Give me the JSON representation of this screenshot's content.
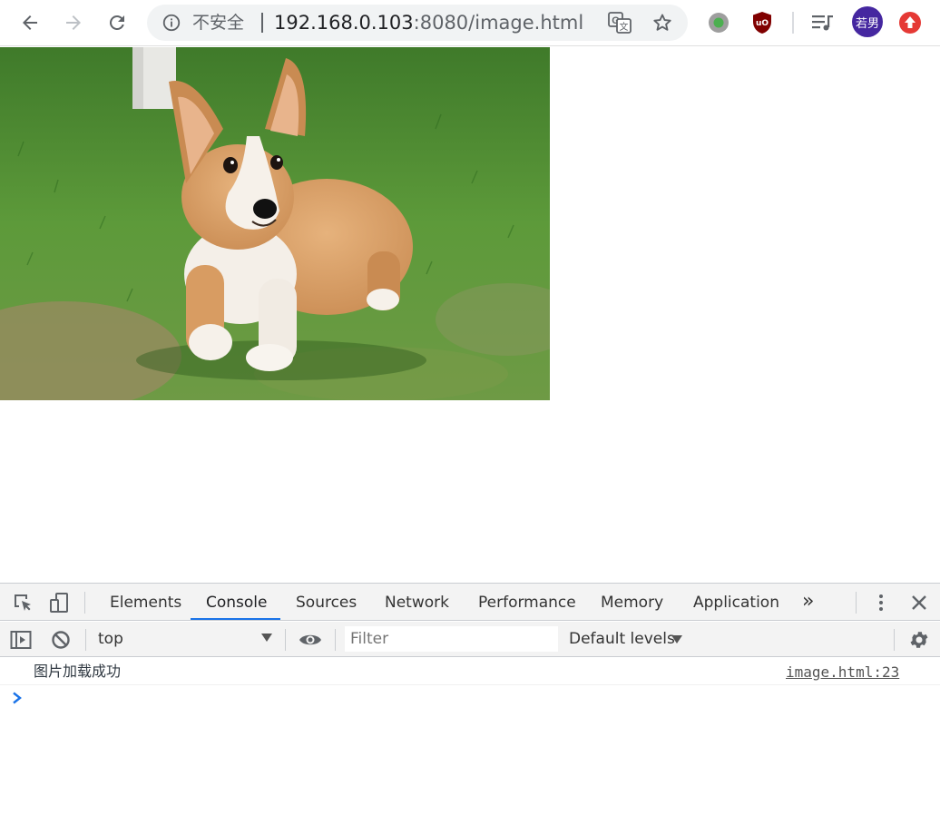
{
  "browser": {
    "security_label": "不安全",
    "url_host": "192.168.0.103",
    "url_rest": ":8080/image.html",
    "profile_name": "若男",
    "colors": {
      "avatar": "#4527a0",
      "ublock": "#800000",
      "ext_green": "#4caf50",
      "update_red": "#e53935"
    }
  },
  "page": {
    "image_alt": "corgi puppy on grass"
  },
  "devtools": {
    "tabs": [
      {
        "label": "Elements"
      },
      {
        "label": "Console"
      },
      {
        "label": "Sources"
      },
      {
        "label": "Network"
      },
      {
        "label": "Performance"
      },
      {
        "label": "Memory"
      },
      {
        "label": "Application"
      }
    ],
    "active_tab": "Console",
    "more_tabs_label": "»",
    "context": "top",
    "filter_placeholder": "Filter",
    "levels": "Default levels",
    "messages": [
      {
        "text": "图片加载成功",
        "source": "image.html:23"
      }
    ]
  }
}
